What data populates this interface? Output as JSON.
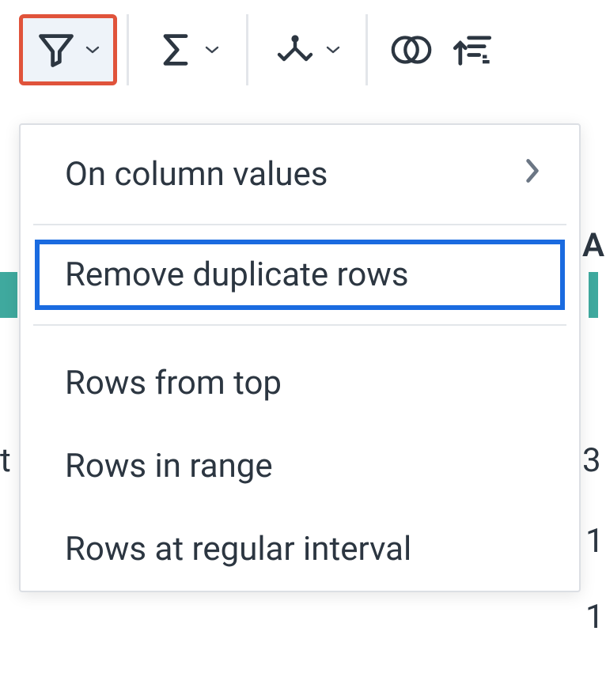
{
  "toolbar": {
    "filter_icon": "filter-icon",
    "summarize_icon": "sigma-icon",
    "split_icon": "split-icon",
    "join_icon": "join-icon",
    "sort_icon": "sort-icon"
  },
  "menu": {
    "on_column_values": "On column values",
    "remove_duplicate_rows": "Remove duplicate rows",
    "rows_from_top": "Rows from top",
    "rows_in_range": "Rows in range",
    "rows_at_regular_interval": "Rows at regular interval"
  },
  "background": {
    "char_A": "A",
    "char_t": "t",
    "char_3": "3",
    "char_n1": "1",
    "char_n2": "1"
  }
}
